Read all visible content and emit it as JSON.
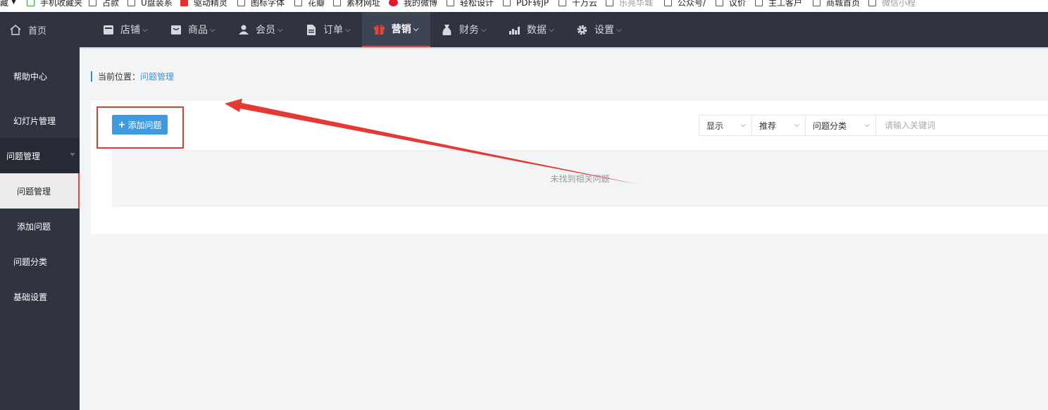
{
  "bookmarks": [
    {
      "label": "藏",
      "icon": "chevron-down-icon"
    },
    {
      "label": "手机收藏夹",
      "icon": "mobile-icon"
    },
    {
      "label": "占款",
      "icon": "folder-icon"
    },
    {
      "label": "U盘装系",
      "icon": "folder-icon"
    },
    {
      "label": "驱动精灵",
      "icon": "driver-icon"
    },
    {
      "label": "图标字体",
      "icon": "folder-icon"
    },
    {
      "label": "花瓣",
      "icon": "folder-icon"
    },
    {
      "label": "素材网址",
      "icon": "folder-icon"
    },
    {
      "label": "我的微博",
      "icon": "weibo-icon"
    },
    {
      "label": "轻松设计",
      "icon": "folder-icon"
    },
    {
      "label": "PDF转JP",
      "icon": "folder-icon"
    },
    {
      "label": "十万云",
      "icon": "folder-icon"
    },
    {
      "label": "乐亮华城",
      "icon": "folder-icon"
    },
    {
      "label": "公众号/",
      "icon": "folder-icon"
    },
    {
      "label": "议价",
      "icon": "folder-icon"
    },
    {
      "label": "主工客户",
      "icon": "folder-icon"
    },
    {
      "label": "商城首页",
      "icon": "folder-icon"
    },
    {
      "label": "微信小程",
      "icon": "folder-icon"
    }
  ],
  "topnav": {
    "home": "首页",
    "items": [
      {
        "label": "店铺",
        "icon": "store-icon"
      },
      {
        "label": "商品",
        "icon": "goods-icon"
      },
      {
        "label": "会员",
        "icon": "user-icon"
      },
      {
        "label": "订单",
        "icon": "order-icon"
      },
      {
        "label": "营销",
        "icon": "gift-icon",
        "active": true
      },
      {
        "label": "财务",
        "icon": "money-bag-icon"
      },
      {
        "label": "数据",
        "icon": "chart-icon"
      },
      {
        "label": "设置",
        "icon": "gear-icon"
      }
    ],
    "active_color": "#e6443a"
  },
  "sidebar": {
    "items": [
      {
        "label": "帮助中心"
      },
      {
        "label": "幻灯片管理"
      },
      {
        "label": "问题管理"
      },
      {
        "label": "问题管理"
      },
      {
        "label": "添加问题"
      },
      {
        "label": "问题分类"
      },
      {
        "label": "基础设置"
      }
    ]
  },
  "breadcrumb": {
    "prefix": "当前位置：",
    "current": "问题管理"
  },
  "toolbar": {
    "add_label": "添加问题",
    "filters": [
      {
        "label": "显示"
      },
      {
        "label": "推荐"
      },
      {
        "label": "问题分类"
      }
    ],
    "keyword_placeholder": "请输入关键词"
  },
  "table": {
    "empty_text": "未找到相关问题"
  },
  "colors": {
    "nav_bg": "#2f3440",
    "accent_blue": "#3f9be0",
    "annotation_red": "#e53935"
  }
}
